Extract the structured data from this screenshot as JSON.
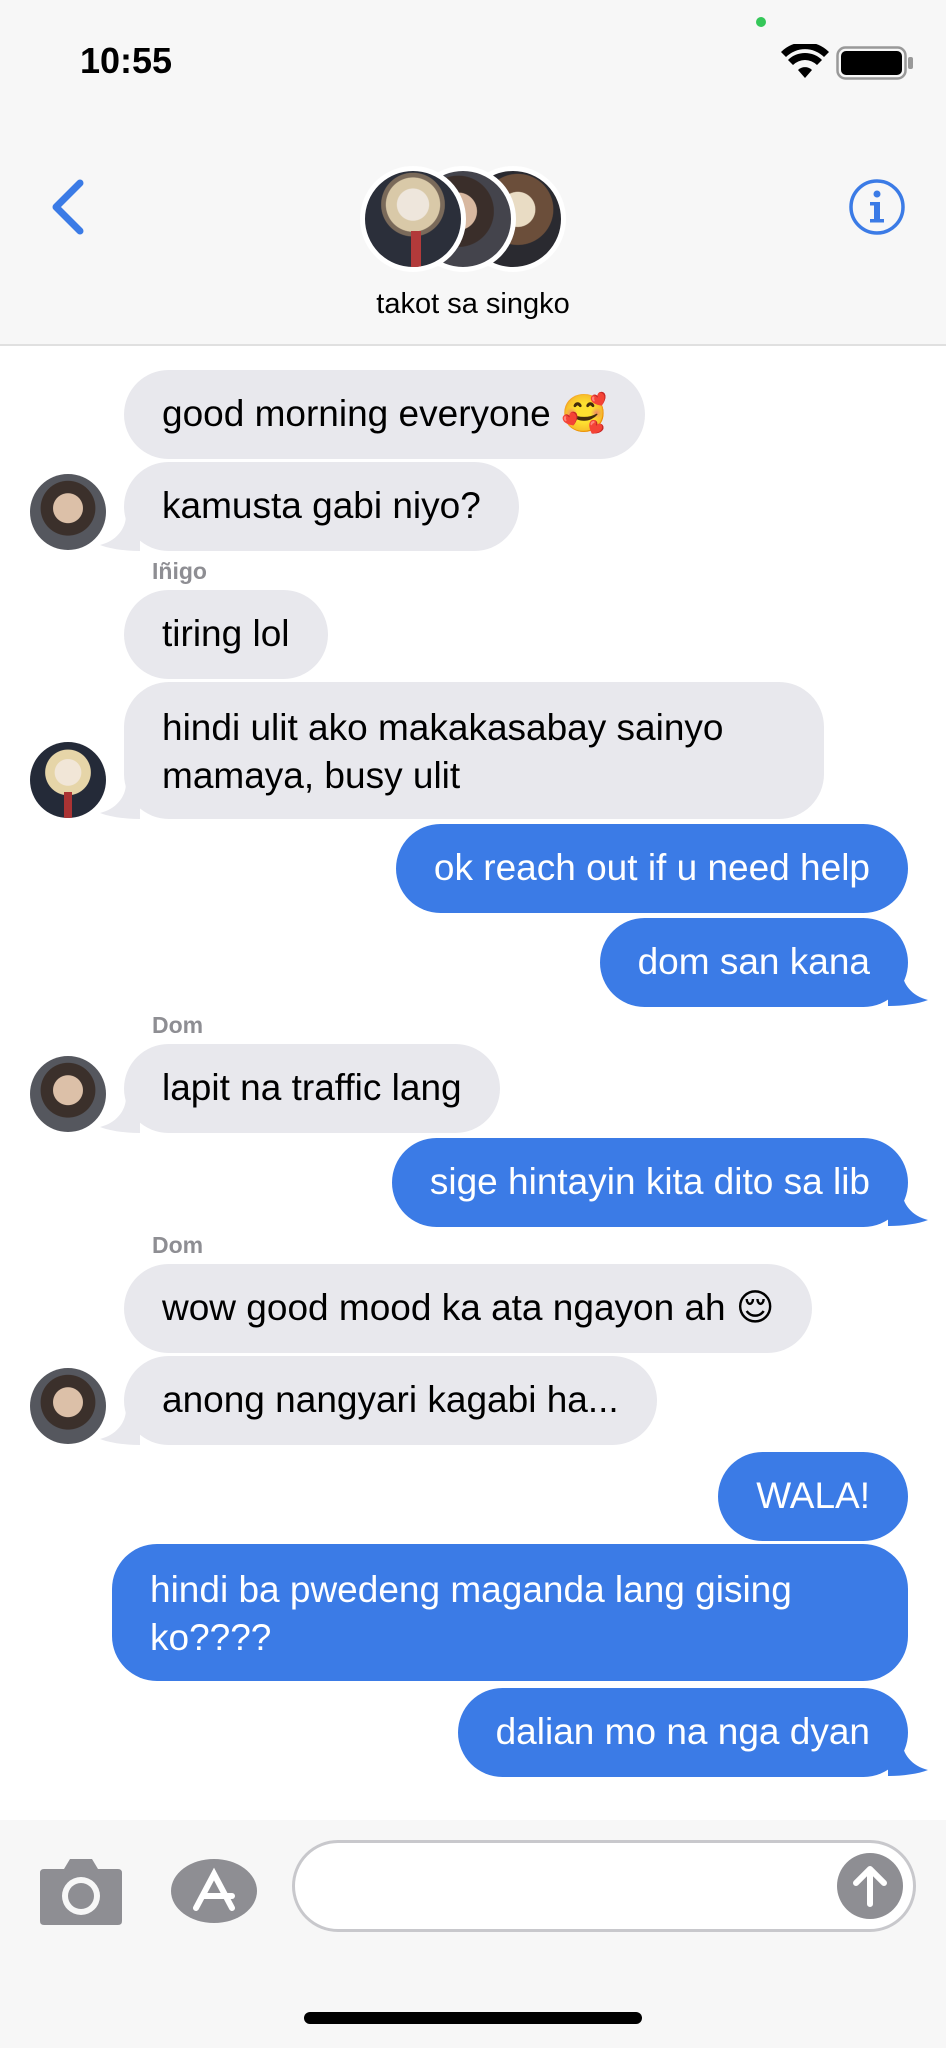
{
  "status_bar": {
    "time": "10:55"
  },
  "header": {
    "group_name": "takot sa singko"
  },
  "messages": [
    {
      "id": "m1",
      "text": "good morning everyone 🥰"
    },
    {
      "id": "m2",
      "text": "kamusta gabi niyo?"
    },
    {
      "id": "s1",
      "sender": "Iñigo"
    },
    {
      "id": "m3",
      "text": "tiring lol"
    },
    {
      "id": "m4",
      "text": "hindi ulit ako makakasabay sainyo mamaya, busy ulit"
    },
    {
      "id": "m5",
      "text": "ok reach out if u need help"
    },
    {
      "id": "m6",
      "text": "dom san kana"
    },
    {
      "id": "s2",
      "sender": "Dom"
    },
    {
      "id": "m7",
      "text": "lapit na traffic lang"
    },
    {
      "id": "m8",
      "text": "sige hintayin kita dito sa lib"
    },
    {
      "id": "s3",
      "sender": "Dom"
    },
    {
      "id": "m9",
      "text": "wow good mood ka ata ngayon ah 😌"
    },
    {
      "id": "m10",
      "text": "anong nangyari kagabi ha..."
    },
    {
      "id": "m11",
      "text": "WALA!"
    },
    {
      "id": "m12",
      "text": "hindi ba pwedeng maganda lang gising ko????"
    },
    {
      "id": "m13",
      "text": "dalian mo na nga dyan"
    }
  ],
  "input": {
    "value": "",
    "placeholder": ""
  },
  "icons": {
    "back": "chevron-left-icon",
    "info": "info-icon",
    "camera": "camera-icon",
    "apps": "app-store-icon",
    "send": "arrow-up-icon",
    "wifi": "wifi-icon",
    "battery": "battery-icon"
  },
  "colors": {
    "accent": "#3b7be6",
    "incoming_bubble": "#e8e8ed",
    "outgoing_bubble": "#3b7be6",
    "header_bg": "#f7f7f7"
  }
}
